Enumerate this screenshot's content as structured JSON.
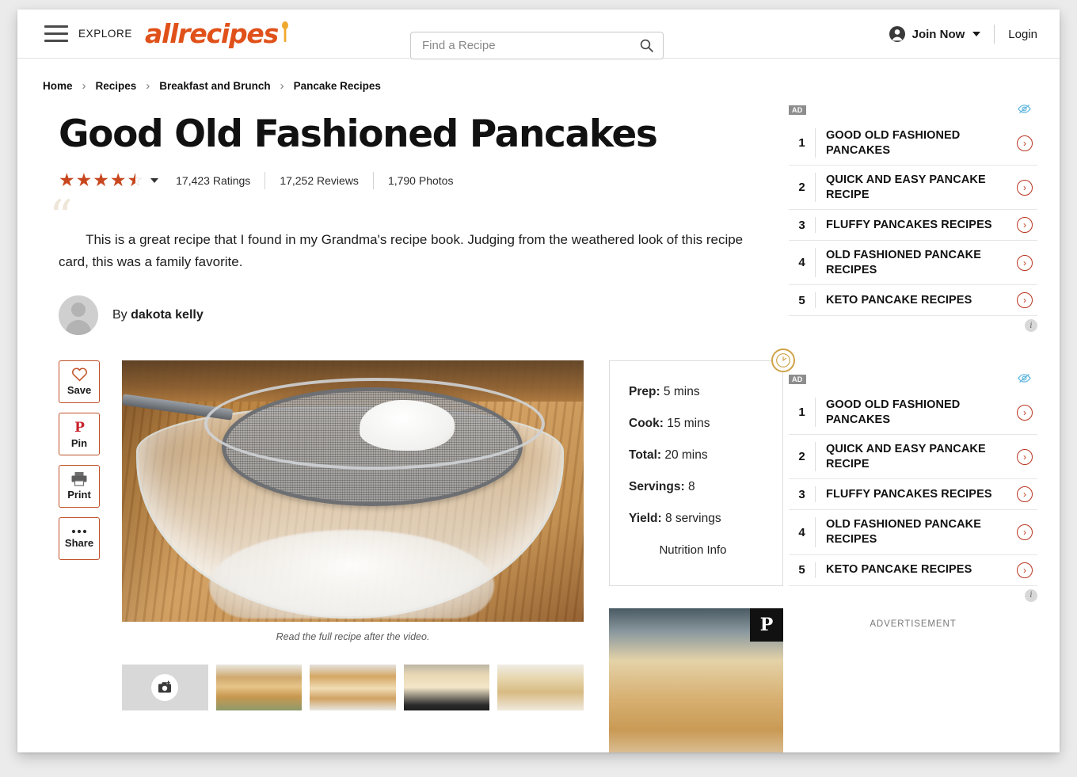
{
  "header": {
    "explore_label": "EXPLORE",
    "logo_text": "allrecipes",
    "search_placeholder": "Find a Recipe",
    "search_value": "",
    "join_label": "Join Now",
    "login_label": "Login"
  },
  "breadcrumb": [
    {
      "label": "Home"
    },
    {
      "label": "Recipes"
    },
    {
      "label": "Breakfast and Brunch"
    },
    {
      "label": "Pancake Recipes"
    }
  ],
  "breadcrumb_separator": "›",
  "recipe": {
    "title": "Good Old Fashioned Pancakes",
    "rating_value": 4.5,
    "ratings_label": "17,423 Ratings",
    "reviews_label": "17,252 Reviews",
    "photos_label": "1,790 Photos",
    "description": "This is a great recipe that I found in my Grandma's recipe book. Judging from the weathered look of this recipe card, this was a family favorite.",
    "by_prefix": "By ",
    "author": "dakota kelly",
    "video_caption": "Read the full recipe after the video."
  },
  "actions": [
    {
      "label": "Save",
      "icon": "heart-icon"
    },
    {
      "label": "Pin",
      "icon": "pinterest-icon"
    },
    {
      "label": "Print",
      "icon": "printer-icon"
    },
    {
      "label": "Share",
      "icon": "ellipsis-icon"
    }
  ],
  "info_card": {
    "rows": [
      {
        "label": "Prep:",
        "value": " 5 mins"
      },
      {
        "label": "Cook:",
        "value": " 15 mins"
      },
      {
        "label": "Total:",
        "value": " 20 mins"
      },
      {
        "label": "Servings:",
        "value": " 8"
      },
      {
        "label": "Yield:",
        "value": " 8 servings"
      }
    ],
    "nutrition_label": "Nutrition Info",
    "clock_icon": "clock-icon"
  },
  "thumbnails": [
    {
      "name": "add-photo-thumbnail",
      "icon": "add-camera-icon"
    },
    {
      "name": "pancake-thumbnail-1"
    },
    {
      "name": "pancake-thumbnail-2"
    },
    {
      "name": "pancake-thumbnail-3"
    },
    {
      "name": "pancake-thumbnail-4"
    }
  ],
  "sidebar": {
    "ad_tag": "AD",
    "ad_blocks": [
      {
        "items": [
          {
            "rank": "1",
            "text": "GOOD OLD FASHIONED PANCAKES"
          },
          {
            "rank": "2",
            "text": "QUICK AND EASY PANCAKE RECIPE"
          },
          {
            "rank": "3",
            "text": "FLUFFY PANCAKES RECIPES"
          },
          {
            "rank": "4",
            "text": "OLD FASHIONED PANCAKE RECIPES"
          },
          {
            "rank": "5",
            "text": "KETO PANCAKE RECIPES"
          }
        ]
      },
      {
        "items": [
          {
            "rank": "1",
            "text": "GOOD OLD FASHIONED PANCAKES"
          },
          {
            "rank": "2",
            "text": "QUICK AND EASY PANCAKE RECIPE"
          },
          {
            "rank": "3",
            "text": "FLUFFY PANCAKES RECIPES"
          },
          {
            "rank": "4",
            "text": "OLD FASHIONED PANCAKE RECIPES"
          },
          {
            "rank": "5",
            "text": "KETO PANCAKE RECIPES"
          }
        ]
      }
    ],
    "advertisement_label": "ADVERTISEMENT",
    "arrow_glyph": "›",
    "info_glyph": "i"
  },
  "colors": {
    "brand_orange": "#e0511a",
    "accent_red": "#c0522a",
    "star_red": "#c8461e",
    "ad_arrow_red": "#b8351e",
    "clock_gold": "#cfa349"
  }
}
